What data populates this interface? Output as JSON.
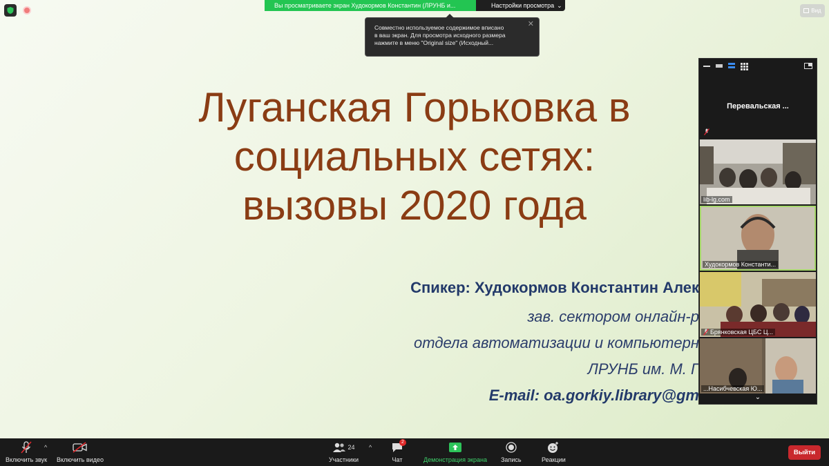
{
  "share_banner": {
    "text": "Вы просматриваете экран Худокормов Константин (ЛРУНБ и...",
    "view_settings_label": "Настройки просмотра",
    "view_settings_caret": "⌄"
  },
  "tooltip": {
    "lines": [
      "Совместно используемое содержимое вписано",
      "в ваш экран. Для просмотра исходного размера",
      "нажмите в  меню \"Original size\" (Исходный..."
    ],
    "close": "✕"
  },
  "view_button": {
    "label": "Вид"
  },
  "slide": {
    "title_lines": [
      "Луганская Горьковка в",
      "социальных сетях:",
      "вызовы 2020 года"
    ],
    "speaker_line": "Спикер: Худокормов Константин Алек",
    "role_line1": "зав. сектором онлайн-р",
    "role_line2": "отдела автоматизации и компьютерн",
    "role_line3": "ЛРУНБ им. М. Г",
    "email_line": "E-mail: oa.gorkiy.library@gm"
  },
  "participants": {
    "tiles": [
      {
        "name": "Перевальская ..."
      },
      {
        "name": "lib-lg.com"
      },
      {
        "name": "Худокормов Константи..."
      },
      {
        "name": "Брянковская ЦБС Ц..."
      },
      {
        "name": "...Насибчевская Ю..."
      }
    ],
    "scroll_down": "⌄"
  },
  "toolbar": {
    "unmute_label": "Включить звук",
    "start_video_label": "Включить видео",
    "participants_label": "Участники",
    "participants_count": "24",
    "chat_label": "Чат",
    "chat_badge": "2",
    "share_label": "Демонстрация экрана",
    "record_label": "Запись",
    "reactions_label": "Реакции",
    "leave_label": "Выйти",
    "caret": "^"
  },
  "colors": {
    "title": "#8a3c14",
    "speaker": "#233a6a",
    "share_green": "#23c552",
    "leave_red": "#c9282d"
  }
}
